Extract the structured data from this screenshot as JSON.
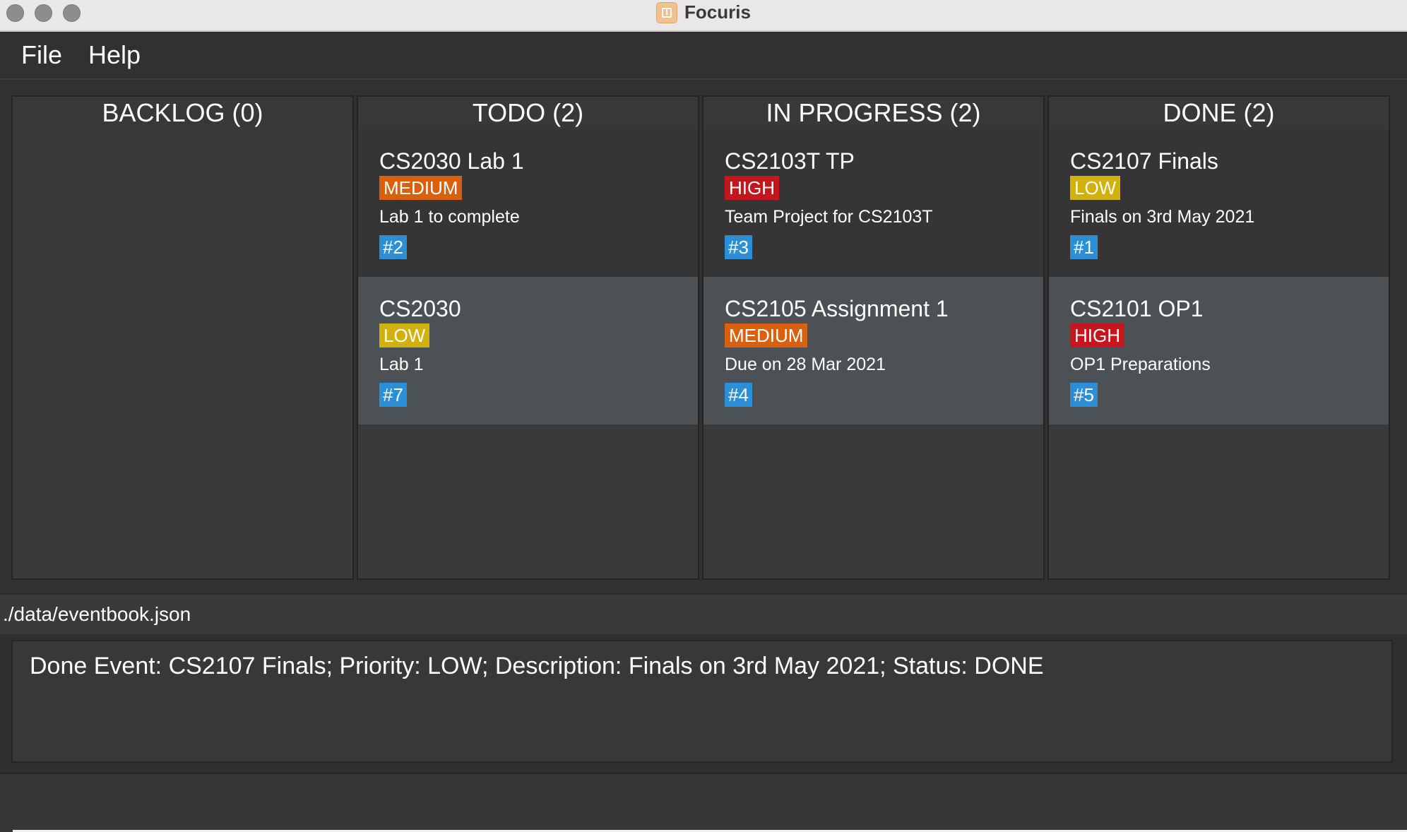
{
  "window": {
    "title": "Focuris"
  },
  "menu": {
    "file": "File",
    "help": "Help"
  },
  "colors": {
    "high": "#c4161c",
    "medium": "#d9600f",
    "low": "#d3b10c",
    "id": "#2a8fd6"
  },
  "columns": [
    {
      "header": "BACKLOG (0)",
      "cards": []
    },
    {
      "header": "TODO (2)",
      "cards": [
        {
          "title": "CS2030 Lab 1",
          "priority": "MEDIUM",
          "description": "Lab 1 to complete",
          "id": "#2"
        },
        {
          "title": "CS2030",
          "priority": "LOW",
          "description": "Lab 1",
          "id": "#7"
        }
      ]
    },
    {
      "header": "IN PROGRESS (2)",
      "cards": [
        {
          "title": "CS2103T TP",
          "priority": "HIGH",
          "description": "Team Project for CS2103T",
          "id": "#3"
        },
        {
          "title": "CS2105 Assignment 1",
          "priority": "MEDIUM",
          "description": "Due on 28 Mar 2021",
          "id": "#4"
        }
      ]
    },
    {
      "header": "DONE (2)",
      "cards": [
        {
          "title": "CS2107 Finals",
          "priority": "LOW",
          "description": "Finals on 3rd May 2021",
          "id": "#1"
        },
        {
          "title": "CS2101 OP1",
          "priority": "HIGH",
          "description": "OP1 Preparations",
          "id": "#5"
        }
      ]
    }
  ],
  "status": {
    "path": "./data/eventbook.json"
  },
  "result": {
    "text": "Done Event: CS2107 Finals; Priority: LOW; Description: Finals on 3rd May 2021; Status: DONE"
  }
}
